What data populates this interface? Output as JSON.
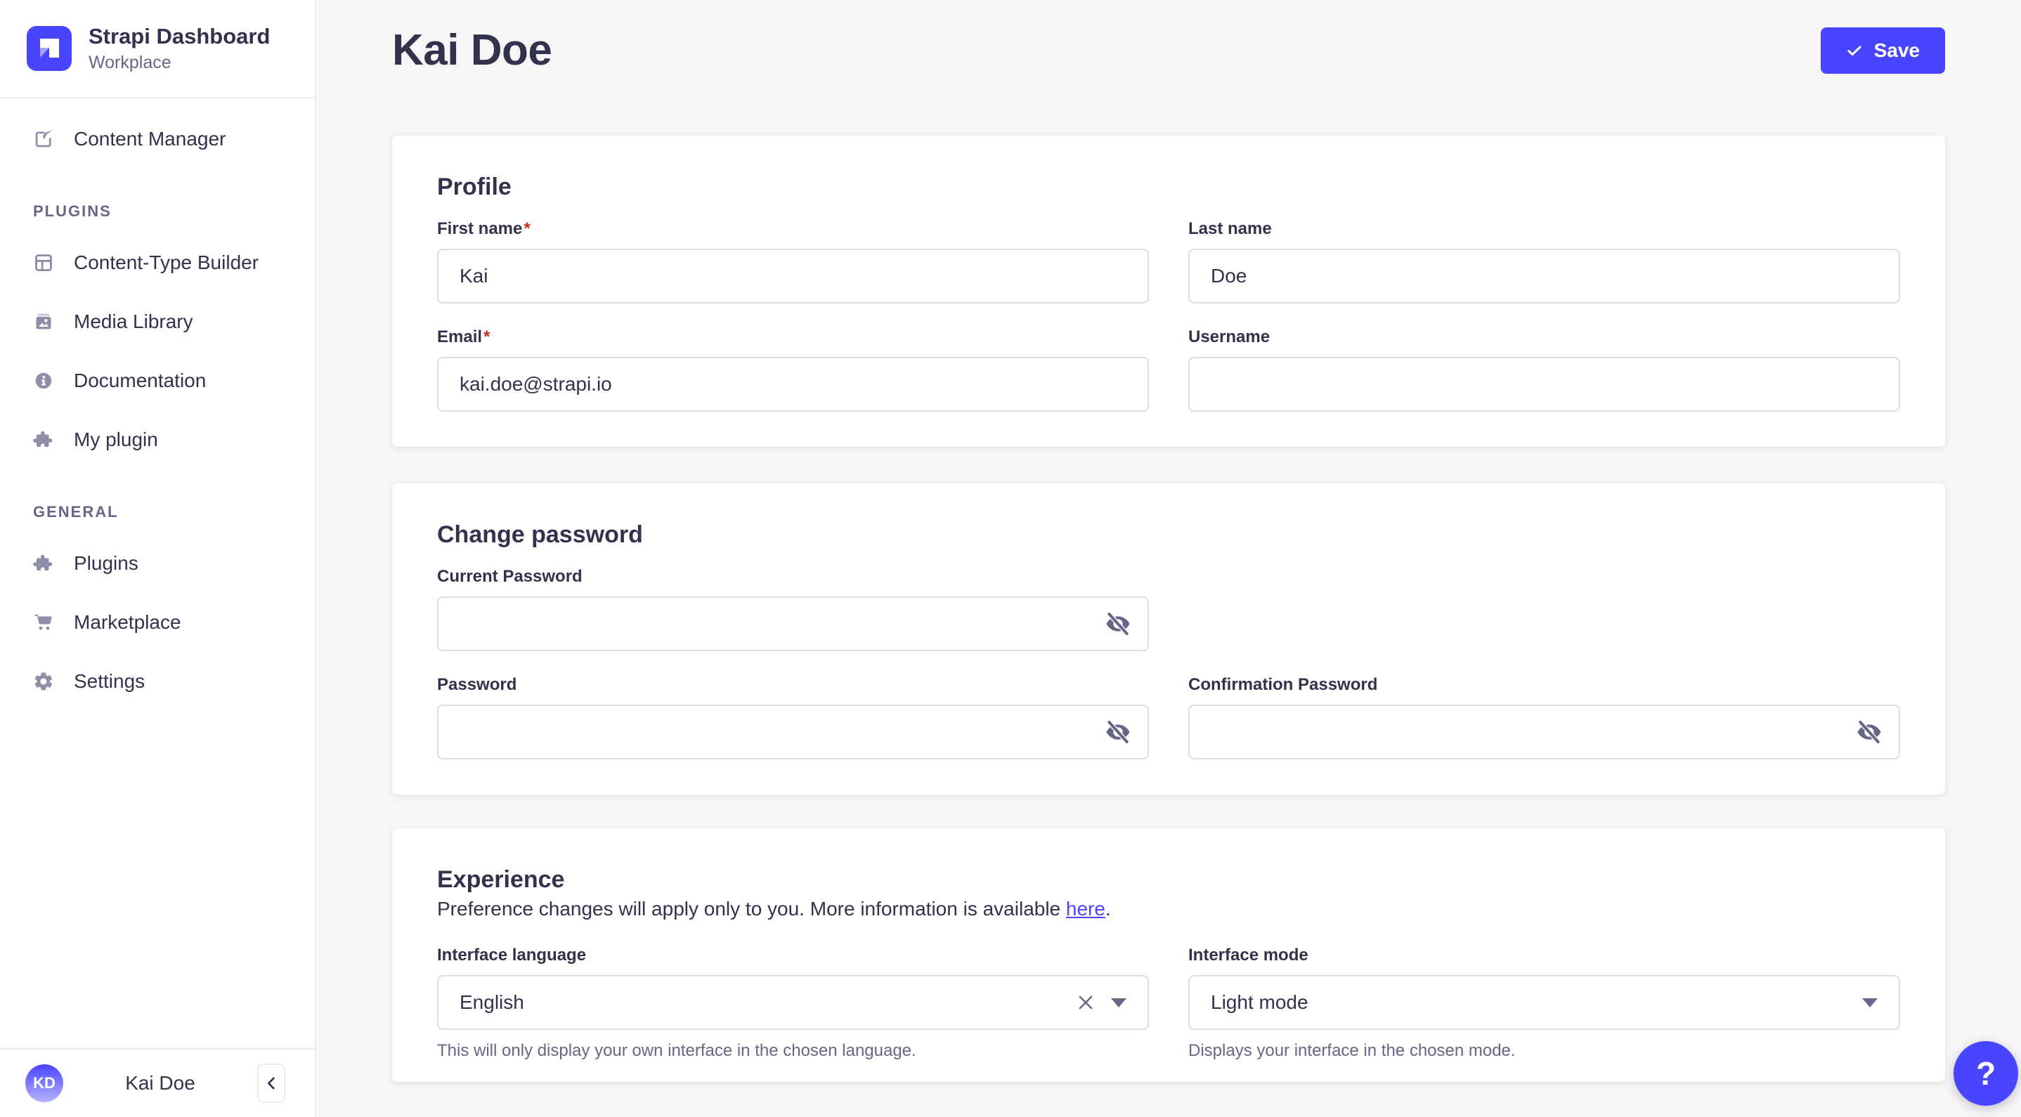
{
  "app": {
    "name": "Strapi Dashboard",
    "workspace": "Workplace",
    "logo_icon": "strapi-logo"
  },
  "misc": {
    "required_marker": "*"
  },
  "colors": {
    "primary": "#4945ff",
    "danger": "#d02b20",
    "text_dark": "#32324d",
    "text_muted": "#666687",
    "icon": "#8e8ea9",
    "border": "#dcdce4",
    "bg": "#f6f6f9"
  },
  "sidebar": {
    "sections": [
      {
        "label": "",
        "items": [
          {
            "icon": "content-manager-icon",
            "label": "Content Manager"
          }
        ]
      },
      {
        "label": "PLUGINS",
        "items": [
          {
            "icon": "content-type-builder-icon",
            "label": "Content-Type Builder"
          },
          {
            "icon": "media-library-icon",
            "label": "Media Library"
          },
          {
            "icon": "documentation-icon",
            "label": "Documentation"
          },
          {
            "icon": "puzzle-icon",
            "label": "My plugin"
          }
        ]
      },
      {
        "label": "GENERAL",
        "items": [
          {
            "icon": "puzzle-icon",
            "label": "Plugins"
          },
          {
            "icon": "cart-icon",
            "label": "Marketplace"
          },
          {
            "icon": "gear-icon",
            "label": "Settings"
          }
        ]
      }
    ],
    "footer": {
      "initials": "KD",
      "user_name": "Kai Doe",
      "collapse_icon": "chevron-left-icon"
    }
  },
  "header": {
    "title": "Kai Doe",
    "save_label": "Save",
    "save_icon": "check-icon"
  },
  "profile": {
    "heading": "Profile",
    "fields": {
      "first_name": {
        "label": "First name",
        "value": "Kai"
      },
      "last_name": {
        "label": "Last name",
        "value": "Doe"
      },
      "email": {
        "label": "Email",
        "value": "kai.doe@strapi.io"
      },
      "username": {
        "label": "Username",
        "value": ""
      }
    }
  },
  "change_password": {
    "heading": "Change password",
    "fields": {
      "current": {
        "label": "Current Password",
        "value": ""
      },
      "new": {
        "label": "Password",
        "value": ""
      },
      "confirm": {
        "label": "Confirmation Password",
        "value": ""
      }
    },
    "toggle_icon": "eye-off-icon"
  },
  "experience": {
    "heading": "Experience",
    "description_prefix": "Preference changes will apply only to you. More information is available ",
    "link_label": "here",
    "description_suffix": ".",
    "interface_language": {
      "label": "Interface language",
      "value": "English",
      "hint": "This will only display your own interface in the chosen language."
    },
    "interface_mode": {
      "label": "Interface mode",
      "value": "Light mode",
      "hint": "Displays your interface in the chosen mode."
    }
  },
  "help": {
    "label": "?"
  }
}
